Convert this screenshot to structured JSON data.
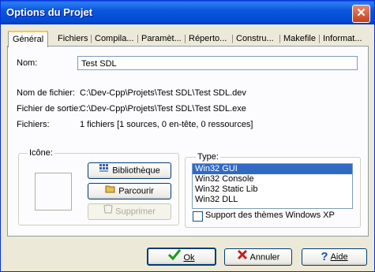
{
  "window": {
    "title": "Options du Projet",
    "close_glyph": "✕"
  },
  "tabs": [
    "Général",
    "Fichiers",
    "Compila...",
    "Paramèt...",
    "Réperto...",
    "Constru...",
    "Makefile",
    "Informat..."
  ],
  "general": {
    "name_label": "Nom:",
    "name_value": "Test SDL",
    "filename_label": "Nom de fichier:",
    "filename_value": "C:\\Dev-Cpp\\Projets\\Test SDL\\Test SDL.dev",
    "output_label": "Fichier de sortie:",
    "output_value": "C:\\Dev-Cpp\\Projets\\Test SDL\\Test SDL.exe",
    "files_label": "Fichiers:",
    "files_value": "1 fichiers [1 sources, 0 en-tête, 0 ressources]"
  },
  "icon_group": {
    "title": "Icône:",
    "library_button": "Bibliothèque",
    "browse_button": "Parcourir",
    "delete_button": "Supprimer"
  },
  "type_group": {
    "title": "Type:",
    "options": [
      "Win32 GUI",
      "Win32 Console",
      "Win32 Static Lib",
      "Win32 DLL"
    ],
    "selected": "Win32 GUI",
    "xp_themes_label": "Support des thèmes Windows XP",
    "xp_themes_checked": false
  },
  "footer": {
    "ok_label": "Ok",
    "cancel_label": "Annuler",
    "help_label": "Aide"
  }
}
